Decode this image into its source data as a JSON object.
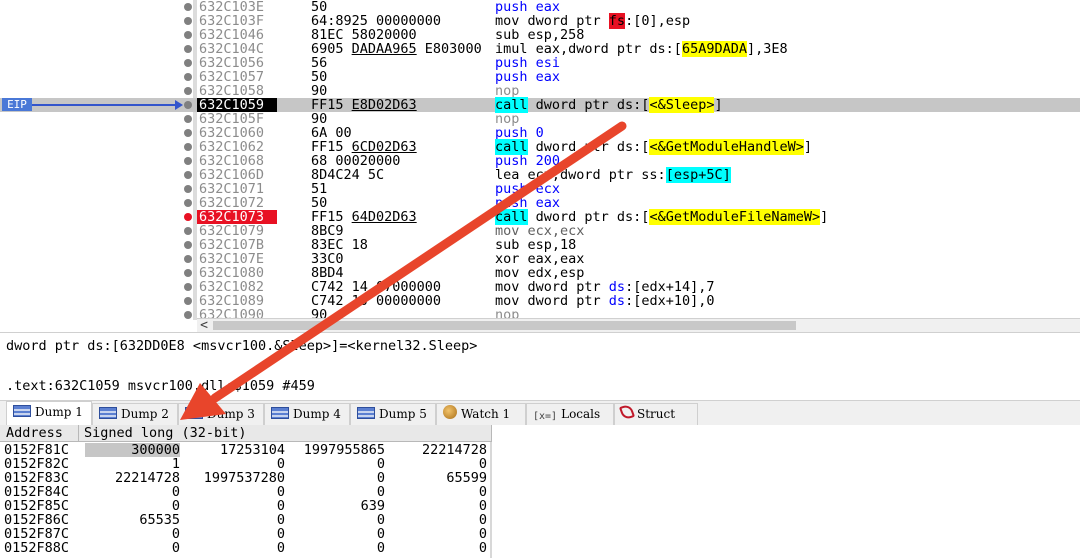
{
  "disasm": {
    "eip_label": "EIP",
    "rows": [
      {
        "addr": "632C103E",
        "bytes": "50",
        "bytes_u": "",
        "bytes_tail": "",
        "ins": [
          {
            "t": "push eax",
            "c": "c-push"
          }
        ],
        "kind": "normal"
      },
      {
        "addr": "632C103F",
        "bytes": "64:8925 00000000",
        "bytes_u": "",
        "bytes_tail": "",
        "ins": [
          {
            "t": "mov dword ptr ",
            "c": "c-dark"
          },
          {
            "t": "fs",
            "c": "hl-r"
          },
          {
            "t": ":[0],esp",
            "c": "c-dark"
          }
        ],
        "kind": "normal"
      },
      {
        "addr": "632C1046",
        "bytes": "81EC 58020000",
        "bytes_u": "",
        "bytes_tail": "",
        "ins": [
          {
            "t": "sub esp,258",
            "c": "c-dark"
          }
        ],
        "kind": "normal"
      },
      {
        "addr": "632C104C",
        "bytes": "6905 ",
        "bytes_u": "DADAA965",
        "bytes_tail": " E803000",
        "ins": [
          {
            "t": "imul eax,dword ptr ds:[",
            "c": "c-dark"
          },
          {
            "t": "65A9DADA",
            "c": "hl-y"
          },
          {
            "t": "],3E8",
            "c": "c-dark"
          }
        ],
        "kind": "normal"
      },
      {
        "addr": "632C1056",
        "bytes": "56",
        "bytes_u": "",
        "bytes_tail": "",
        "ins": [
          {
            "t": "push esi",
            "c": "c-push"
          }
        ],
        "kind": "normal"
      },
      {
        "addr": "632C1057",
        "bytes": "50",
        "bytes_u": "",
        "bytes_tail": "",
        "ins": [
          {
            "t": "push eax",
            "c": "c-push"
          }
        ],
        "kind": "normal"
      },
      {
        "addr": "632C1058",
        "bytes": "90",
        "bytes_u": "",
        "bytes_tail": "",
        "ins": [
          {
            "t": "nop",
            "c": "c-nop"
          }
        ],
        "kind": "normal"
      },
      {
        "addr": "632C1059",
        "bytes": "FF15 ",
        "bytes_u": "E8D02D63",
        "bytes_tail": "",
        "ins": [
          {
            "t": "call",
            "c": "c-call"
          },
          {
            "t": " dword ptr ds:[",
            "c": "c-dark"
          },
          {
            "t": "<&Sleep>",
            "c": "hl-y"
          },
          {
            "t": "]",
            "c": "c-dark"
          }
        ],
        "kind": "cur"
      },
      {
        "addr": "632C105F",
        "bytes": "90",
        "bytes_u": "",
        "bytes_tail": "",
        "ins": [
          {
            "t": "nop",
            "c": "c-nop"
          }
        ],
        "kind": "normal"
      },
      {
        "addr": "632C1060",
        "bytes": "6A 00",
        "bytes_u": "",
        "bytes_tail": "",
        "ins": [
          {
            "t": "push 0",
            "c": "c-push"
          }
        ],
        "kind": "normal"
      },
      {
        "addr": "632C1062",
        "bytes": "FF15 ",
        "bytes_u": "6CD02D63",
        "bytes_tail": "",
        "ins": [
          {
            "t": "call",
            "c": "c-call"
          },
          {
            "t": " dword ptr ds:[",
            "c": "c-dark"
          },
          {
            "t": "<&GetModuleHandleW>",
            "c": "hl-y"
          },
          {
            "t": "]",
            "c": "c-dark"
          }
        ],
        "kind": "normal"
      },
      {
        "addr": "632C1068",
        "bytes": "68 00020000",
        "bytes_u": "",
        "bytes_tail": "",
        "ins": [
          {
            "t": "push 200",
            "c": "c-push"
          }
        ],
        "kind": "normal"
      },
      {
        "addr": "632C106D",
        "bytes": "8D4C24 5C",
        "bytes_u": "",
        "bytes_tail": "",
        "ins": [
          {
            "t": "lea ecx,dword ptr ss:",
            "c": "c-dark"
          },
          {
            "t": "[esp+5C]",
            "c": "hl-c"
          }
        ],
        "kind": "normal"
      },
      {
        "addr": "632C1071",
        "bytes": "51",
        "bytes_u": "",
        "bytes_tail": "",
        "ins": [
          {
            "t": "push ecx",
            "c": "c-push"
          }
        ],
        "kind": "normal"
      },
      {
        "addr": "632C1072",
        "bytes": "50",
        "bytes_u": "",
        "bytes_tail": "",
        "ins": [
          {
            "t": "push eax",
            "c": "c-push"
          }
        ],
        "kind": "normal"
      },
      {
        "addr": "632C1073",
        "bytes": "FF15 ",
        "bytes_u": "64D02D63",
        "bytes_tail": "",
        "ins": [
          {
            "t": "call",
            "c": "c-call"
          },
          {
            "t": " dword ptr ds:[",
            "c": "c-dark"
          },
          {
            "t": "<&GetModuleFileNameW>",
            "c": "hl-y"
          },
          {
            "t": "]",
            "c": "c-dark"
          }
        ],
        "kind": "bp"
      },
      {
        "addr": "632C1079",
        "bytes": "8BC9",
        "bytes_u": "",
        "bytes_tail": "",
        "ins": [
          {
            "t": "mov ecx,ecx",
            "c": "c-gray"
          }
        ],
        "kind": "normal"
      },
      {
        "addr": "632C107B",
        "bytes": "83EC 18",
        "bytes_u": "",
        "bytes_tail": "",
        "ins": [
          {
            "t": "sub esp,18",
            "c": "c-dark"
          }
        ],
        "kind": "normal"
      },
      {
        "addr": "632C107E",
        "bytes": "33C0",
        "bytes_u": "",
        "bytes_tail": "",
        "ins": [
          {
            "t": "xor eax,eax",
            "c": "c-dark"
          }
        ],
        "kind": "normal"
      },
      {
        "addr": "632C1080",
        "bytes": "8BD4",
        "bytes_u": "",
        "bytes_tail": "",
        "ins": [
          {
            "t": "mov edx,esp",
            "c": "c-dark"
          }
        ],
        "kind": "normal"
      },
      {
        "addr": "632C1082",
        "bytes": "C742 14 07000000",
        "bytes_u": "",
        "bytes_tail": "",
        "ins": [
          {
            "t": "mov dword ptr ",
            "c": "c-dark"
          },
          {
            "t": "ds",
            "c": "c-blue"
          },
          {
            "t": ":[edx+14],7",
            "c": "c-dark"
          }
        ],
        "kind": "normal"
      },
      {
        "addr": "632C1089",
        "bytes": "C742 10 00000000",
        "bytes_u": "",
        "bytes_tail": "",
        "ins": [
          {
            "t": "mov dword ptr ",
            "c": "c-dark"
          },
          {
            "t": "ds",
            "c": "c-blue"
          },
          {
            "t": ":[edx+10],0",
            "c": "c-dark"
          }
        ],
        "kind": "normal"
      },
      {
        "addr": "632C1090",
        "bytes": "90",
        "bytes_u": "",
        "bytes_tail": "",
        "ins": [
          {
            "t": "nop",
            "c": "c-nop"
          }
        ],
        "kind": "normal"
      }
    ]
  },
  "scroll": {
    "left_arrow": "<"
  },
  "info": {
    "line1": "dword ptr ds:[632DD0E8 <msvcr100.&Sleep>]=<kernel32.Sleep>",
    "line2": ".text:632C1059 msvcr100.dll:$1059 #459"
  },
  "tabs": [
    {
      "label": "Dump 1",
      "icon": "dump-icon",
      "active": true
    },
    {
      "label": "Dump 2",
      "icon": "dump-icon",
      "active": false
    },
    {
      "label": "Dump 3",
      "icon": "dump-icon",
      "active": false
    },
    {
      "label": "Dump 4",
      "icon": "dump-icon",
      "active": false
    },
    {
      "label": "Dump 5",
      "icon": "dump-icon",
      "active": false
    },
    {
      "label": "Watch 1",
      "icon": "watch-icon",
      "active": false
    },
    {
      "label": "Locals",
      "icon": "locals-icon",
      "icon_text": "[x=]",
      "active": false
    },
    {
      "label": "Struct",
      "icon": "struct-icon",
      "active": false
    }
  ],
  "dump": {
    "header_address": "Address",
    "header_type": "Signed long (32-bit)",
    "rows": [
      {
        "addr": "0152F81C",
        "vals": [
          "300000",
          "17253104",
          "1997955865",
          "22214728"
        ]
      },
      {
        "addr": "0152F82C",
        "vals": [
          "1",
          "0",
          "0",
          "0"
        ]
      },
      {
        "addr": "0152F83C",
        "vals": [
          "22214728",
          "1997537280",
          "0",
          "65599"
        ]
      },
      {
        "addr": "0152F84C",
        "vals": [
          "0",
          "0",
          "0",
          "0"
        ]
      },
      {
        "addr": "0152F85C",
        "vals": [
          "0",
          "0",
          "639",
          "0"
        ]
      },
      {
        "addr": "0152F86C",
        "vals": [
          "65535",
          "0",
          "0",
          "0"
        ]
      },
      {
        "addr": "0152F87C",
        "vals": [
          "0",
          "0",
          "0",
          "0"
        ]
      },
      {
        "addr": "0152F88C",
        "vals": [
          "0",
          "0",
          "0",
          "0"
        ]
      }
    ]
  },
  "colors": {
    "annotation_arrow": "#e8452b",
    "eip_marker": "#3355cc",
    "breakpoint": "#e81123"
  }
}
